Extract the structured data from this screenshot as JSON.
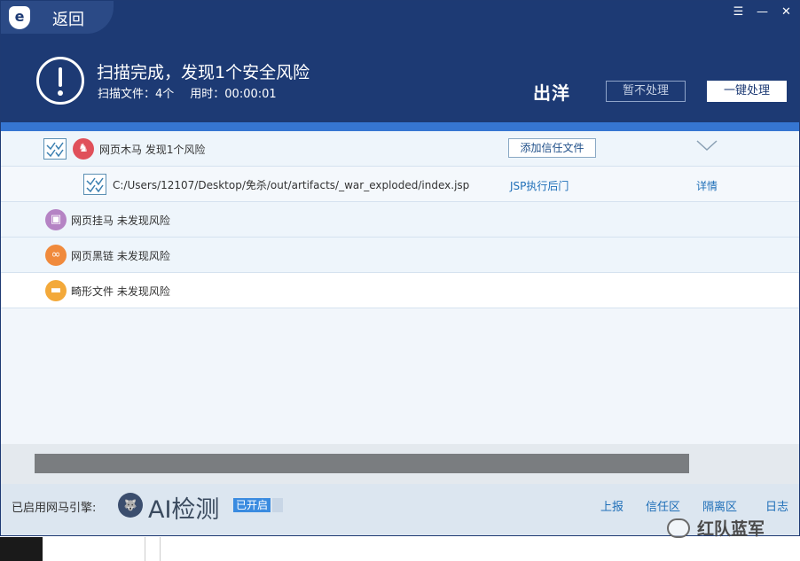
{
  "header": {
    "back_label": "返回",
    "scan_title": "扫描完成，发现1个安全风险",
    "files_scanned": "扫描文件：4个",
    "time_used": "用时：00:00:01",
    "brand_text": "出洋",
    "ignore_button": "暂不处理",
    "fix_button": "一键处理"
  },
  "results": {
    "trojan": {
      "label": "网页木马 发现1个风险",
      "trust_button": "添加信任文件"
    },
    "finding": {
      "path": "C:/Users/12107/Desktop/免杀/out/artifacts/_war_exploded/index.jsp",
      "type": "JSP执行后门",
      "details": "详情"
    },
    "hang_horse": {
      "label": "网页挂马 未发现风险"
    },
    "black_chain": {
      "label": "网页黑链 未发现风险"
    },
    "malformed": {
      "label": "畸形文件 未发现风险"
    }
  },
  "progress": {
    "value": 1.0
  },
  "footer": {
    "engine_label": "已启用网马引擎:",
    "ai_label": "AI检测",
    "status_badge": "已开启",
    "links": [
      "上报",
      "信任区",
      "隔离区",
      "日志"
    ]
  },
  "watermark": {
    "text": "红队蓝军"
  },
  "colors": {
    "header": "#1d3a74",
    "accent": "#3676d2",
    "link": "#1f6fb8"
  },
  "icons": {
    "trojan": "trojan-horse-icon",
    "hang_horse": "web-hang-horse-icon",
    "black_chain": "link-icon",
    "malformed": "folder-icon"
  }
}
